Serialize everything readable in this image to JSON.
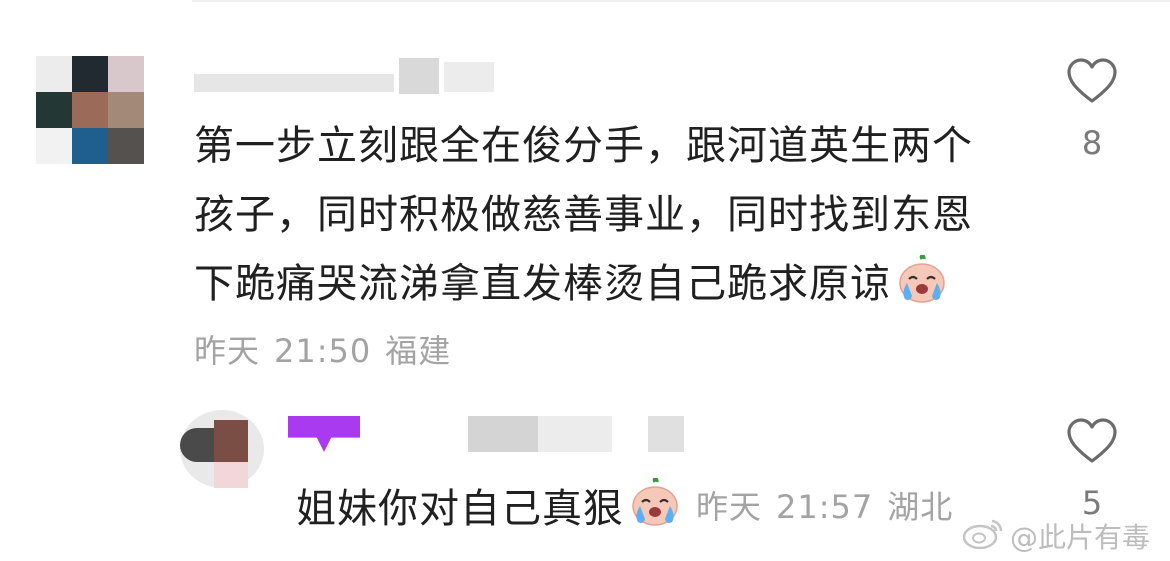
{
  "comments": [
    {
      "text": "第一步立刻跟全在俊分手，跟河道英生两个孩子，同时积极做慈善事业，同时找到东恩下跪痛哭流涕拿直发棒烫自己跪求原谅",
      "lines": [
        "第一步立刻跟全在俊分手，跟河道英生两个",
        "孩子，同时积极做慈善事业，同时找到东恩",
        "下跪痛哭流涕拿直发棒烫自己跪求原谅"
      ],
      "date": "昨天",
      "time": "21:50",
      "location": "福建",
      "likes": "8",
      "emoji_icon": "crying-face-icon"
    },
    {
      "text": "姐妹你对自己真狠",
      "date": "昨天",
      "time": "21:57",
      "location": "湖北",
      "likes": "5",
      "emoji_icon": "crying-face-icon"
    }
  ],
  "watermark": {
    "text": "@此片有毒",
    "icon": "weibo-icon"
  },
  "colors": {
    "meta": "#a3a3a3",
    "text": "#202020",
    "heart": "#6b6b6b",
    "badge": "#a93af0"
  }
}
